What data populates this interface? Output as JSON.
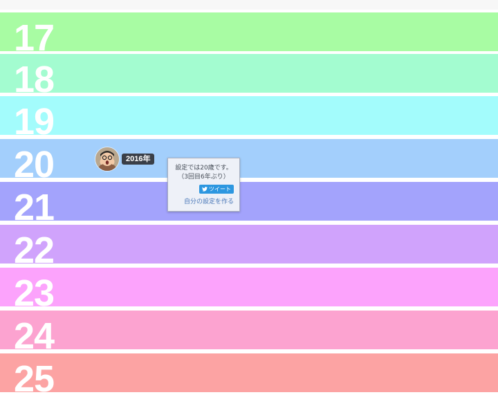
{
  "bands": [
    {
      "age": "17",
      "color": "#a8fca3"
    },
    {
      "age": "18",
      "color": "#a3fcd0"
    },
    {
      "age": "19",
      "color": "#a3fcfc"
    },
    {
      "age": "20",
      "color": "#a3cffc"
    },
    {
      "age": "21",
      "color": "#a3a3fc"
    },
    {
      "age": "22",
      "color": "#d0a3fc"
    },
    {
      "age": "23",
      "color": "#fca3fc"
    },
    {
      "age": "24",
      "color": "#fca3d0"
    },
    {
      "age": "25",
      "color": "#fca3a3"
    }
  ],
  "marker": {
    "year_label": "2016年",
    "avatar_icon": "user-avatar"
  },
  "popup": {
    "line1": "設定では20歳です。",
    "line2": "（3回目6年ぶり）",
    "tweet_label": "ツイート",
    "tweet_icon": "twitter-bird-icon",
    "link_label": "自分の設定を作る"
  },
  "colors": {
    "badge_bg": "#3a3f48",
    "tweet_bg": "#2d97e0",
    "link": "#4a78b8"
  }
}
